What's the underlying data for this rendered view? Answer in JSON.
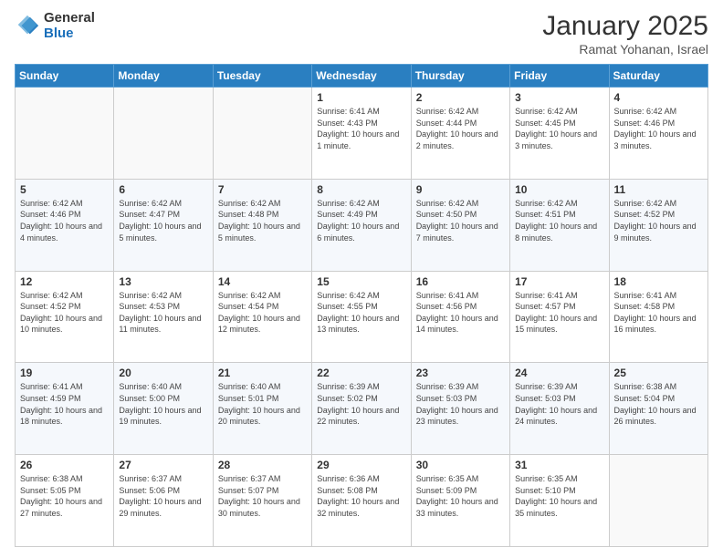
{
  "logo": {
    "general": "General",
    "blue": "Blue"
  },
  "header": {
    "month": "January 2025",
    "location": "Ramat Yohanan, Israel"
  },
  "weekdays": [
    "Sunday",
    "Monday",
    "Tuesday",
    "Wednesday",
    "Thursday",
    "Friday",
    "Saturday"
  ],
  "weeks": [
    [
      {
        "day": "",
        "info": ""
      },
      {
        "day": "",
        "info": ""
      },
      {
        "day": "",
        "info": ""
      },
      {
        "day": "1",
        "info": "Sunrise: 6:41 AM\nSunset: 4:43 PM\nDaylight: 10 hours\nand 1 minute."
      },
      {
        "day": "2",
        "info": "Sunrise: 6:42 AM\nSunset: 4:44 PM\nDaylight: 10 hours\nand 2 minutes."
      },
      {
        "day": "3",
        "info": "Sunrise: 6:42 AM\nSunset: 4:45 PM\nDaylight: 10 hours\nand 3 minutes."
      },
      {
        "day": "4",
        "info": "Sunrise: 6:42 AM\nSunset: 4:46 PM\nDaylight: 10 hours\nand 3 minutes."
      }
    ],
    [
      {
        "day": "5",
        "info": "Sunrise: 6:42 AM\nSunset: 4:46 PM\nDaylight: 10 hours\nand 4 minutes."
      },
      {
        "day": "6",
        "info": "Sunrise: 6:42 AM\nSunset: 4:47 PM\nDaylight: 10 hours\nand 5 minutes."
      },
      {
        "day": "7",
        "info": "Sunrise: 6:42 AM\nSunset: 4:48 PM\nDaylight: 10 hours\nand 5 minutes."
      },
      {
        "day": "8",
        "info": "Sunrise: 6:42 AM\nSunset: 4:49 PM\nDaylight: 10 hours\nand 6 minutes."
      },
      {
        "day": "9",
        "info": "Sunrise: 6:42 AM\nSunset: 4:50 PM\nDaylight: 10 hours\nand 7 minutes."
      },
      {
        "day": "10",
        "info": "Sunrise: 6:42 AM\nSunset: 4:51 PM\nDaylight: 10 hours\nand 8 minutes."
      },
      {
        "day": "11",
        "info": "Sunrise: 6:42 AM\nSunset: 4:52 PM\nDaylight: 10 hours\nand 9 minutes."
      }
    ],
    [
      {
        "day": "12",
        "info": "Sunrise: 6:42 AM\nSunset: 4:52 PM\nDaylight: 10 hours\nand 10 minutes."
      },
      {
        "day": "13",
        "info": "Sunrise: 6:42 AM\nSunset: 4:53 PM\nDaylight: 10 hours\nand 11 minutes."
      },
      {
        "day": "14",
        "info": "Sunrise: 6:42 AM\nSunset: 4:54 PM\nDaylight: 10 hours\nand 12 minutes."
      },
      {
        "day": "15",
        "info": "Sunrise: 6:42 AM\nSunset: 4:55 PM\nDaylight: 10 hours\nand 13 minutes."
      },
      {
        "day": "16",
        "info": "Sunrise: 6:41 AM\nSunset: 4:56 PM\nDaylight: 10 hours\nand 14 minutes."
      },
      {
        "day": "17",
        "info": "Sunrise: 6:41 AM\nSunset: 4:57 PM\nDaylight: 10 hours\nand 15 minutes."
      },
      {
        "day": "18",
        "info": "Sunrise: 6:41 AM\nSunset: 4:58 PM\nDaylight: 10 hours\nand 16 minutes."
      }
    ],
    [
      {
        "day": "19",
        "info": "Sunrise: 6:41 AM\nSunset: 4:59 PM\nDaylight: 10 hours\nand 18 minutes."
      },
      {
        "day": "20",
        "info": "Sunrise: 6:40 AM\nSunset: 5:00 PM\nDaylight: 10 hours\nand 19 minutes."
      },
      {
        "day": "21",
        "info": "Sunrise: 6:40 AM\nSunset: 5:01 PM\nDaylight: 10 hours\nand 20 minutes."
      },
      {
        "day": "22",
        "info": "Sunrise: 6:39 AM\nSunset: 5:02 PM\nDaylight: 10 hours\nand 22 minutes."
      },
      {
        "day": "23",
        "info": "Sunrise: 6:39 AM\nSunset: 5:03 PM\nDaylight: 10 hours\nand 23 minutes."
      },
      {
        "day": "24",
        "info": "Sunrise: 6:39 AM\nSunset: 5:03 PM\nDaylight: 10 hours\nand 24 minutes."
      },
      {
        "day": "25",
        "info": "Sunrise: 6:38 AM\nSunset: 5:04 PM\nDaylight: 10 hours\nand 26 minutes."
      }
    ],
    [
      {
        "day": "26",
        "info": "Sunrise: 6:38 AM\nSunset: 5:05 PM\nDaylight: 10 hours\nand 27 minutes."
      },
      {
        "day": "27",
        "info": "Sunrise: 6:37 AM\nSunset: 5:06 PM\nDaylight: 10 hours\nand 29 minutes."
      },
      {
        "day": "28",
        "info": "Sunrise: 6:37 AM\nSunset: 5:07 PM\nDaylight: 10 hours\nand 30 minutes."
      },
      {
        "day": "29",
        "info": "Sunrise: 6:36 AM\nSunset: 5:08 PM\nDaylight: 10 hours\nand 32 minutes."
      },
      {
        "day": "30",
        "info": "Sunrise: 6:35 AM\nSunset: 5:09 PM\nDaylight: 10 hours\nand 33 minutes."
      },
      {
        "day": "31",
        "info": "Sunrise: 6:35 AM\nSunset: 5:10 PM\nDaylight: 10 hours\nand 35 minutes."
      },
      {
        "day": "",
        "info": ""
      }
    ]
  ]
}
